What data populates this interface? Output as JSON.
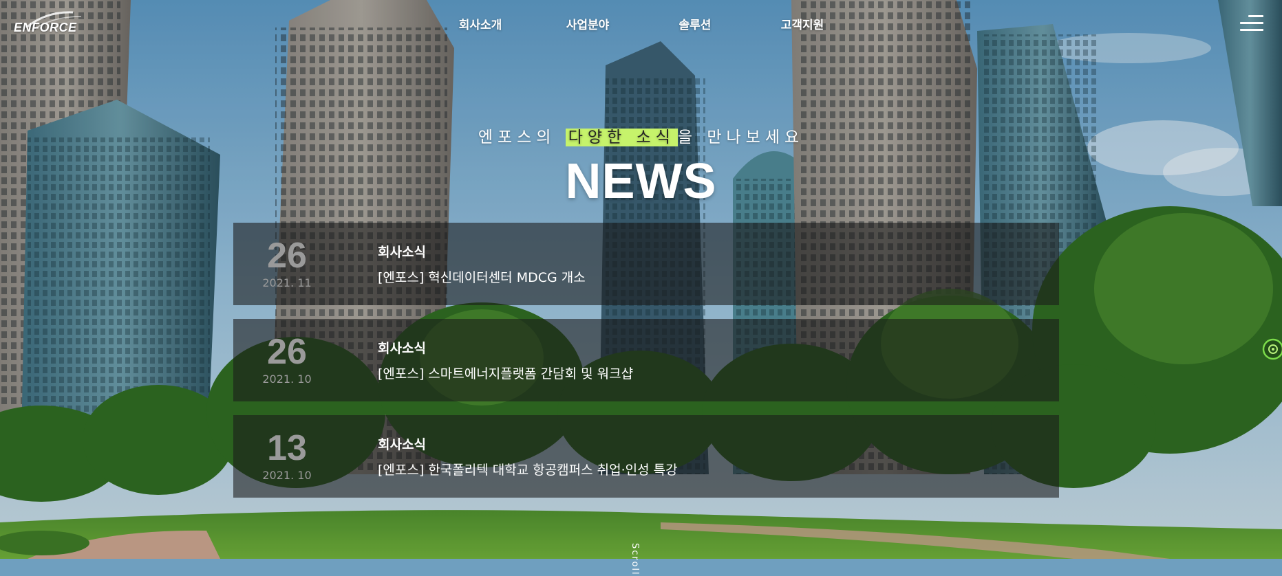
{
  "brand": {
    "logo_text": "ENFORCE"
  },
  "nav": {
    "items": [
      "회사소개",
      "사업분야",
      "솔루션",
      "고객지원"
    ]
  },
  "intro": {
    "sub_prefix": "엔포스의",
    "sub_highlight": "다양한 소식",
    "sub_suffix": "을 만나보세요",
    "title": "NEWS"
  },
  "news": [
    {
      "day": "26",
      "ym": "2021. 11",
      "category": "회사소식",
      "title": "[엔포스] 혁신데이터센터 MDCG 개소"
    },
    {
      "day": "26",
      "ym": "2021. 10",
      "category": "회사소식",
      "title": "[엔포스] 스마트에너지플랫폼 간담회 및 워크샵"
    },
    {
      "day": "13",
      "ym": "2021. 10",
      "category": "회사소식",
      "title": "[엔포스] 한국폴리텍 대학교 항공캠퍼스 취업·인성 특강"
    }
  ],
  "scroll_hint": "Scroll",
  "colors": {
    "highlight": "#c6f36b",
    "panel": "rgba(25,25,25,0.58)"
  },
  "icons": {
    "menu": "hamburger-menu-icon",
    "side": "target-icon"
  }
}
